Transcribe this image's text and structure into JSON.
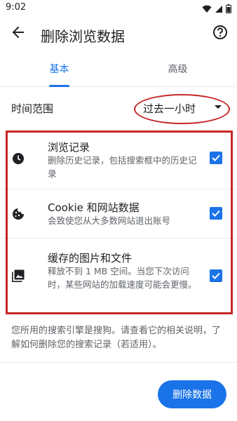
{
  "status_bar": {
    "time": "9:02"
  },
  "header": {
    "title": "删除浏览数据"
  },
  "tabs": [
    {
      "label": "基本"
    },
    {
      "label": "高级"
    }
  ],
  "time_range": {
    "label": "时间范围",
    "value": "过去一小时"
  },
  "options": [
    {
      "title": "浏览记录",
      "description": "删除历史记录，包括搜索框中的历史记录",
      "checked": true,
      "icon": "clock-icon"
    },
    {
      "title": "Cookie 和网站数据",
      "description": "会致使您从大多数网站退出账号",
      "checked": true,
      "icon": "cookie-icon"
    },
    {
      "title": "缓存的图片和文件",
      "description": "释放不到 1 MB 空间。当您下次访问时，某些网站的加载速度可能会更慢。",
      "checked": true,
      "icon": "image-icon"
    }
  ],
  "note": "您所用的搜索引擎是搜狗。请查看它的相关说明，了解如何删除您的搜索记录（若适用）。",
  "clear_button": {
    "label": "删除数据"
  },
  "colors": {
    "accent": "#1a73e8",
    "annotation": "#c62828"
  }
}
